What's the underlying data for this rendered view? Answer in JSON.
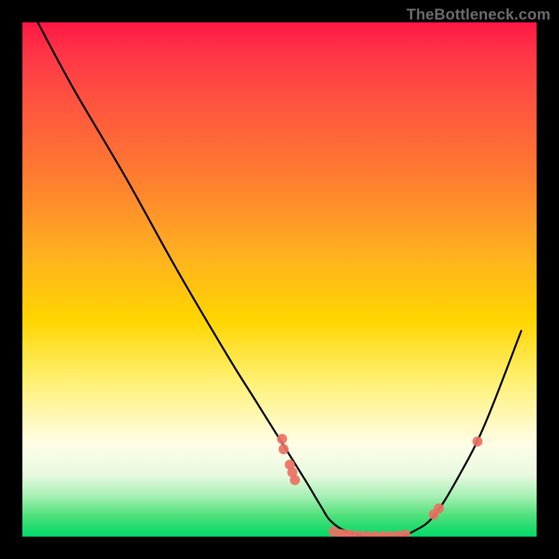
{
  "watermark": "TheBottleneck.com",
  "chart_data": {
    "type": "line",
    "title": "",
    "xlabel": "",
    "ylabel": "",
    "xlim": [
      0,
      100
    ],
    "ylim": [
      0,
      100
    ],
    "grid": false,
    "series": [
      {
        "name": "curve",
        "color": "#000000",
        "x": [
          3,
          10,
          20,
          30,
          40,
          45,
          50,
          55,
          58,
          60,
          63,
          67,
          70,
          73,
          76,
          80,
          85,
          90,
          97
        ],
        "y": [
          100,
          87,
          70,
          52,
          35,
          27,
          19,
          11,
          6,
          3,
          1,
          0,
          0,
          0,
          1,
          4,
          12,
          22,
          40
        ]
      }
    ],
    "markers": {
      "name": "highlighted-points",
      "color": "#ec7063",
      "points": [
        {
          "x": 50.5,
          "y": 19
        },
        {
          "x": 50.8,
          "y": 17
        },
        {
          "x": 52.0,
          "y": 14
        },
        {
          "x": 52.5,
          "y": 12.5
        },
        {
          "x": 53.0,
          "y": 11
        },
        {
          "x": 60.5,
          "y": 1
        },
        {
          "x": 62.0,
          "y": 0.5
        },
        {
          "x": 63.0,
          "y": 0.4
        },
        {
          "x": 64.0,
          "y": 0.3
        },
        {
          "x": 65.5,
          "y": 0.2
        },
        {
          "x": 67.0,
          "y": 0.15
        },
        {
          "x": 68.5,
          "y": 0.1
        },
        {
          "x": 70.0,
          "y": 0.1
        },
        {
          "x": 71.5,
          "y": 0.1
        },
        {
          "x": 73.0,
          "y": 0.2
        },
        {
          "x": 74.5,
          "y": 0.4
        },
        {
          "x": 80.0,
          "y": 4.3
        },
        {
          "x": 81.0,
          "y": 5.5
        },
        {
          "x": 88.5,
          "y": 18.5
        }
      ]
    },
    "gradient_stops": [
      {
        "pos": 0,
        "color": "#ff1744"
      },
      {
        "pos": 0.58,
        "color": "#ffd600"
      },
      {
        "pos": 1.0,
        "color": "#00d968"
      }
    ]
  }
}
